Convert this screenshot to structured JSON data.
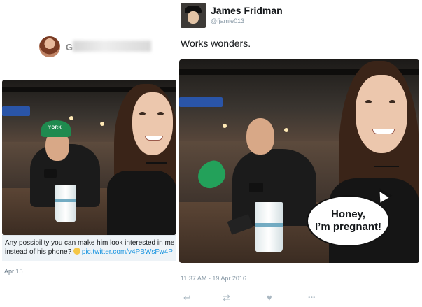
{
  "left_tweet": {
    "caption_text": "Any possibility you can make him look interested in me instead of his phone?",
    "caption_link": "pic.twitter.com/v4PBWsFw4P",
    "date": "Apr 15",
    "cap_logo": "YORK"
  },
  "right_tweet": {
    "name": "James Fridman",
    "handle": "@fjamie013",
    "text": "Works wonders.",
    "bubble_line1": "Honey,",
    "bubble_line2": "I’m pregnant!",
    "timestamp": "11:37 AM - 19 Apr 2016"
  },
  "actions": [
    {
      "name": "reply-icon",
      "glyph": "↩"
    },
    {
      "name": "retweet-icon",
      "glyph": "⇄"
    },
    {
      "name": "like-icon",
      "glyph": "♥"
    },
    {
      "name": "more-icon",
      "glyph": "•••"
    }
  ],
  "colors": {
    "link": "#1b95e0",
    "muted": "#8899a6",
    "cap_green": "#1f8a4f"
  }
}
